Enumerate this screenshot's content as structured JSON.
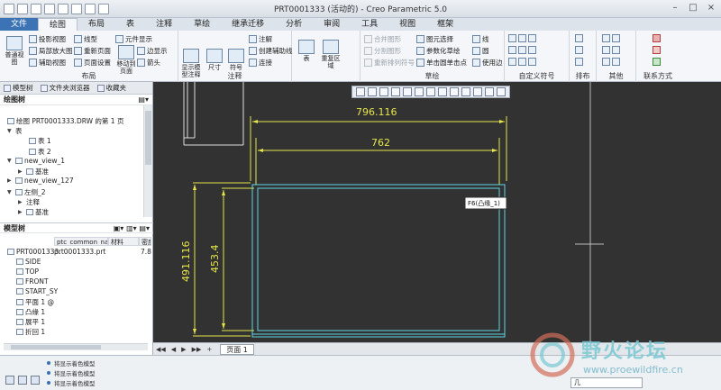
{
  "window": {
    "title": "PRT0001333 (活动的) - Creo Parametric 5.0"
  },
  "tabs": [
    {
      "label": "文件"
    },
    {
      "label": "布局"
    },
    {
      "label": "表"
    },
    {
      "label": "注释"
    },
    {
      "label": "草绘"
    },
    {
      "label": "继承迁移"
    },
    {
      "label": "分析"
    },
    {
      "label": "审阅"
    },
    {
      "label": "工具"
    },
    {
      "label": "视图"
    },
    {
      "label": "框架"
    }
  ],
  "active_tab_partial": "绘图",
  "ribbon": {
    "layout_group": {
      "label": "布局",
      "big_btn": "普通视图",
      "items": [
        "投影视图",
        "局部放大图",
        "辅助视图",
        "线型",
        "重新页面",
        "页面设置",
        "元件显示",
        "边显示",
        "箭头",
        "移动到页面"
      ]
    },
    "annotation_group": {
      "label": "注释",
      "items": [
        "显示模型注释",
        "尺寸",
        "符号",
        "注解",
        "创建辅助线",
        "连接"
      ]
    },
    "table_group": {
      "items": [
        "表",
        "重复区域"
      ]
    },
    "sketch_group": {
      "label": "草绘",
      "items": [
        "图元选择",
        "参数化草绘",
        "单击圆单击点",
        "合并图形",
        "分割图形",
        "重新排列符号",
        "线",
        "圆",
        "使用边"
      ]
    },
    "symbol_group": {
      "label": "自定义符号"
    },
    "rank_group": {
      "label": "排布"
    },
    "other_group": {
      "label": "其他"
    },
    "contact_group": {
      "label": "联系方式"
    }
  },
  "left_panel": {
    "tabs": [
      "模型树",
      "文件夹浏览器",
      "收藏夹"
    ],
    "drawing_tree": {
      "title": "绘图树",
      "rows": [
        {
          "text": "绘图 PRT0001333.DRW 的第 1 页"
        },
        {
          "text": "表"
        },
        {
          "text": "表 1"
        },
        {
          "text": "表 2"
        },
        {
          "text": "new_view_1"
        },
        {
          "text": "基准"
        },
        {
          "text": "new_view_127"
        },
        {
          "text": "左侧_2"
        },
        {
          "text": "注释"
        },
        {
          "text": "基准"
        }
      ]
    },
    "model_tree": {
      "title": "模型树",
      "columns": [
        "ptc_common_name",
        "材料",
        "密度"
      ],
      "rows": [
        {
          "name": "PRT0001333.",
          "common": "prt0001333.prt",
          "density": "7.8"
        },
        {
          "name": "SIDE"
        },
        {
          "name": "TOP"
        },
        {
          "name": "FRONT"
        },
        {
          "name": "START_SY"
        },
        {
          "name": "平面 1 @"
        },
        {
          "name": "凸缘 1"
        },
        {
          "name": "展平 1"
        },
        {
          "name": "折回 1"
        }
      ]
    }
  },
  "canvas": {
    "dims": {
      "top1": "796.116",
      "top2": "762",
      "left1": "491.116",
      "left2": "453.4"
    },
    "tooltip": "F6(凸缘_1)"
  },
  "sheetbar": {
    "tab": "页面 1"
  },
  "status": {
    "messages": [
      "将显示着色模型",
      "将显示着色模型",
      "将显示着色模型"
    ],
    "filter": "几"
  },
  "watermark": {
    "cn": "野火论坛",
    "url": "www.proewildfire.cn"
  }
}
